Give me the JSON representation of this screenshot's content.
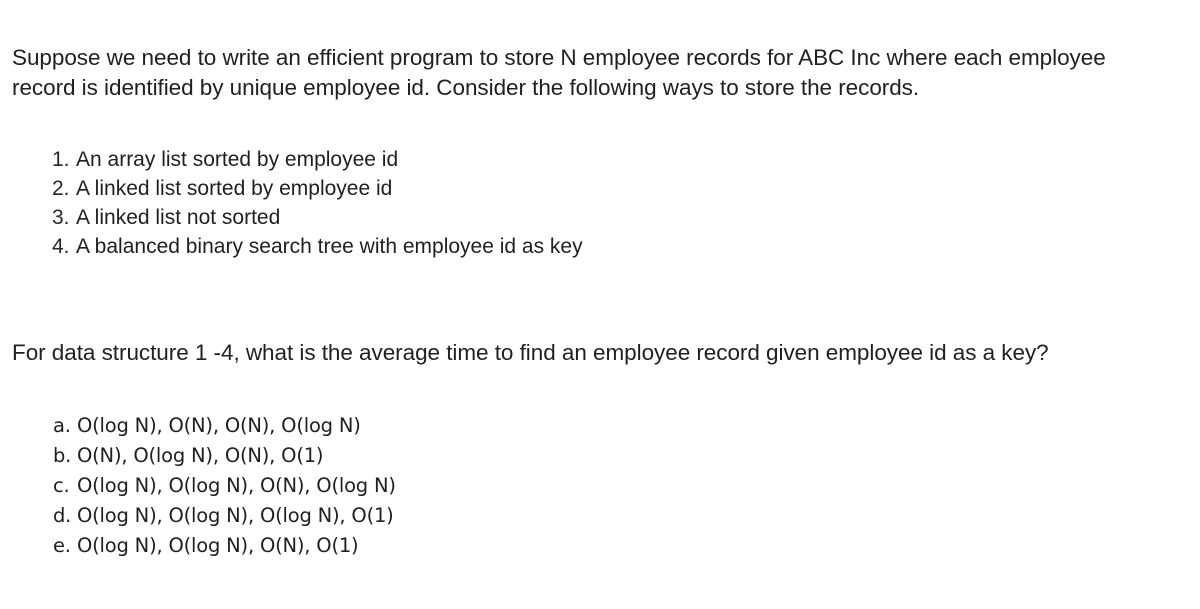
{
  "background_color": "#ffffff",
  "text_color": "#1f1f24",
  "intro": {
    "paragraph": "Suppose we need to write an efficient program to store N employee records for ABC Inc where each employee record is identified by unique employee id. Consider the following ways to store the records."
  },
  "structures": {
    "items": [
      {
        "marker": "1.",
        "label": "An array list sorted by employee id"
      },
      {
        "marker": "2.",
        "label": "A linked list sorted by employee id"
      },
      {
        "marker": "3.",
        "label": "A linked list not sorted"
      },
      {
        "marker": "4.",
        "label": "A balanced binary search tree with employee id as key"
      }
    ]
  },
  "question": {
    "paragraph": "For data structure 1 -4, what is the average time to find an employee record given employee id as a key?"
  },
  "options": {
    "items": [
      {
        "marker": "a.",
        "label": "O(log N), O(N), O(N), O(log N)"
      },
      {
        "marker": "b.",
        "label": "O(N), O(log N), O(N), O(1)"
      },
      {
        "marker": "c.",
        "label": "O(log N), O(log N), O(N), O(log N)"
      },
      {
        "marker": "d.",
        "label": "O(log N), O(log N), O(log N), O(1)"
      },
      {
        "marker": "e.",
        "label": "O(log N), O(log N), O(N), O(1)"
      }
    ]
  }
}
